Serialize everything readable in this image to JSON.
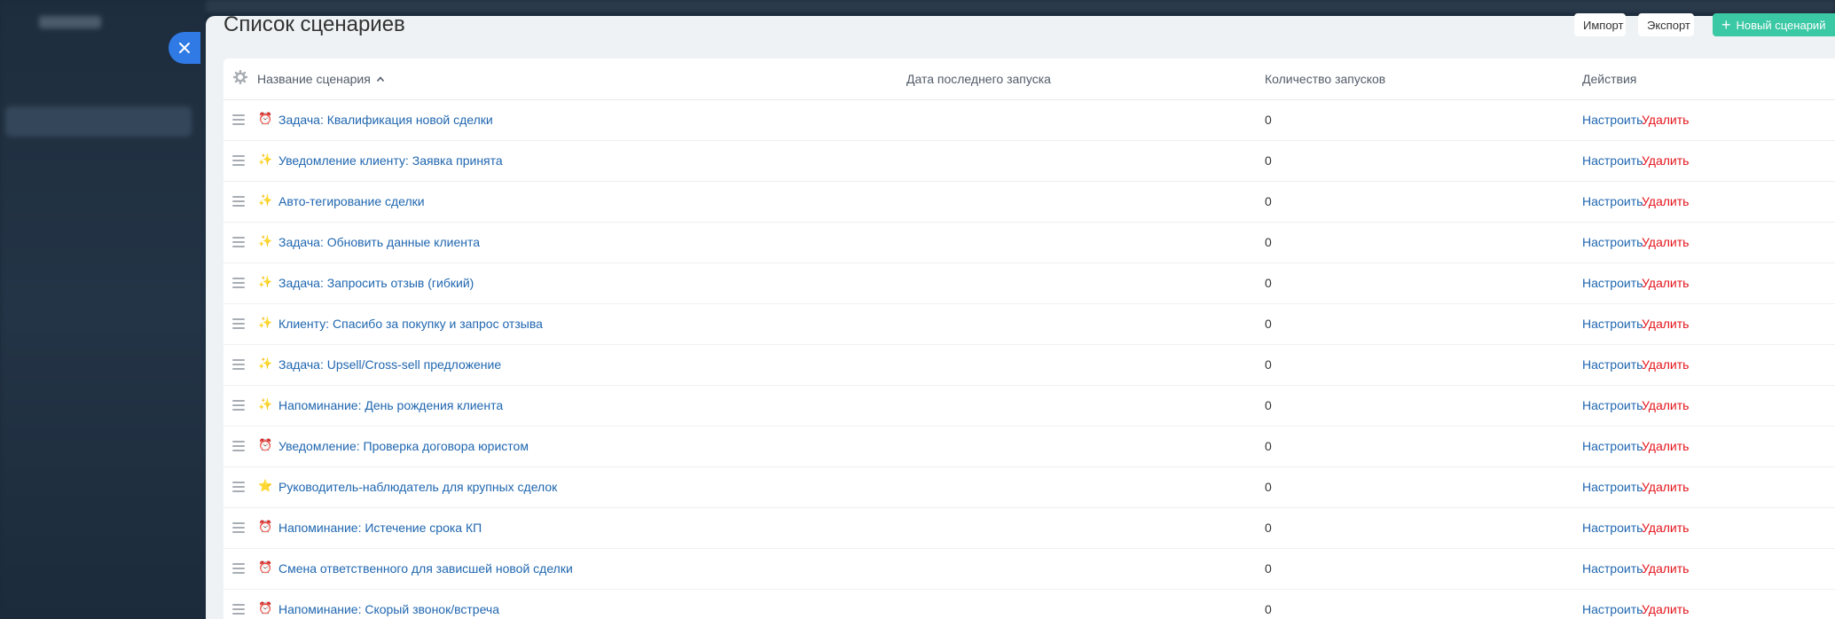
{
  "page_title": "Список сценариев",
  "toolbar": {
    "import_label": "Импорт",
    "export_label": "Экспорт",
    "new_label": "Новый сценарий",
    "accent_color": "#3bc8a4"
  },
  "table": {
    "columns": {
      "name": "Название сценария",
      "last_run": "Дата последнего запуска",
      "run_count": "Количество запусков",
      "actions": "Действия"
    },
    "action_edit": "Настроить",
    "action_delete": "Удалить",
    "rows": [
      {
        "icon": "alarm-clock-icon",
        "name": "Задача: Квалификация новой сделки",
        "last_run": "",
        "count": "0"
      },
      {
        "icon": "sparkles-icon",
        "name": "Уведомление клиенту: Заявка принята",
        "last_run": "",
        "count": "0"
      },
      {
        "icon": "sparkles-icon",
        "name": "Авто-тегирование сделки",
        "last_run": "",
        "count": "0"
      },
      {
        "icon": "sparkles-icon",
        "name": "Задача: Обновить данные клиента",
        "last_run": "",
        "count": "0"
      },
      {
        "icon": "sparkles-icon",
        "name": "Задача: Запросить отзыв (гибкий)",
        "last_run": "",
        "count": "0"
      },
      {
        "icon": "sparkles-icon",
        "name": "Клиенту: Спасибо за покупку и запрос отзыва",
        "last_run": "",
        "count": "0"
      },
      {
        "icon": "sparkles-icon",
        "name": "Задача: Upsell/Cross-sell предложение",
        "last_run": "",
        "count": "0"
      },
      {
        "icon": "sparkles-icon",
        "name": "Напоминание: День рождения клиента",
        "last_run": "",
        "count": "0"
      },
      {
        "icon": "alarm-clock-icon",
        "name": "Уведомление: Проверка договора юристом",
        "last_run": "",
        "count": "0"
      },
      {
        "icon": "star-icon",
        "name": "Руководитель-наблюдатель для крупных сделок",
        "last_run": "",
        "count": "0"
      },
      {
        "icon": "alarm-clock-icon",
        "name": "Напоминание: Истечение срока КП",
        "last_run": "",
        "count": "0"
      },
      {
        "icon": "alarm-clock-icon",
        "name": "Смена ответственного для зависшей новой сделки",
        "last_run": "",
        "count": "0"
      },
      {
        "icon": "alarm-clock-icon",
        "name": "Напоминание: Скорый звонок/встреча",
        "last_run": "",
        "count": "0"
      }
    ]
  }
}
